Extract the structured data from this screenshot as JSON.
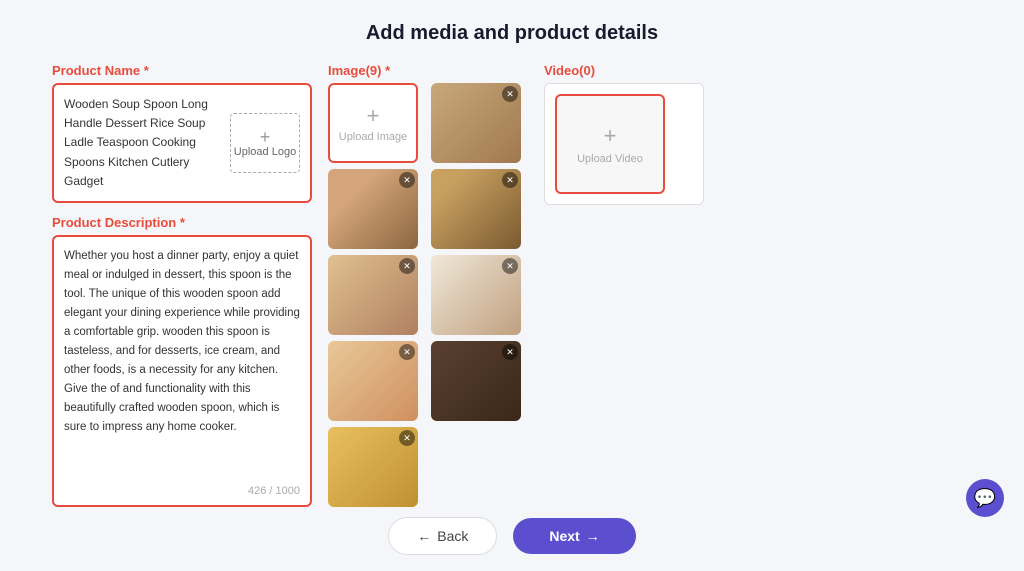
{
  "page": {
    "title": "Add media and product details"
  },
  "product_name": {
    "label": "Product Name",
    "required": "*",
    "value": "Wooden Soup Spoon Long Handle Dessert Rice Soup Ladle Teaspoon Cooking Spoons Kitchen Cutlery Gadget",
    "upload_logo_label": "Upload Logo"
  },
  "product_description": {
    "label": "Product Description",
    "required": "*",
    "value": "Whether you host a dinner party, enjoy a quiet meal or indulged in dessert, this spoon is the tool.\nThe unique of this wooden spoon add elegant your dining experience while providing a comfortable grip.\nwooden this spoon is tasteless, and for desserts, ice cream, and other foods, is a necessity for any kitchen.\nGive the of and functionality with this beautifully crafted wooden spoon, which is sure to impress any home cooker.",
    "char_count": "426 / 1000"
  },
  "image_section": {
    "label": "Image(9)",
    "required": "*",
    "upload_label": "Upload Image",
    "images": [
      {
        "id": 1,
        "cls": "img-spoon-single"
      },
      {
        "id": 2,
        "cls": "img-spoons-bowl"
      },
      {
        "id": 3,
        "cls": "img-bowls"
      },
      {
        "id": 4,
        "cls": "img-spoon-light"
      },
      {
        "id": 5,
        "cls": "img-spoon-white-bg"
      },
      {
        "id": 6,
        "cls": "img-spoon-soup"
      },
      {
        "id": 7,
        "cls": "img-dark-spoons"
      },
      {
        "id": 8,
        "cls": "img-honey-bowl"
      }
    ]
  },
  "video_section": {
    "label": "Video(0)",
    "upload_label": "Upload Video"
  },
  "buttons": {
    "back_label": "Back",
    "next_label": "Next"
  }
}
